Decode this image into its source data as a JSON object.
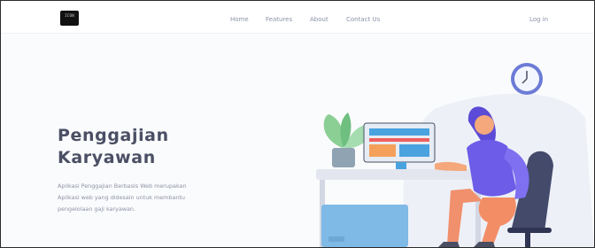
{
  "logo": {
    "text": "ICON"
  },
  "nav": {
    "home": "Home",
    "features": "Features",
    "about": "About",
    "contact": "Contact Us",
    "login": "Log in"
  },
  "hero": {
    "title_line1": "Penggajian",
    "title_line2": "Karyawan",
    "desc_line1": "Aplikasi Penggajian Berbasis Web merupakan",
    "desc_line2": "Aplikasi web yang didesain untuk membantu",
    "desc_line3": "pengelolaan gaji karyawan."
  },
  "colors": {
    "accent": "#6c5ce7",
    "navy": "#4b4f64",
    "plant": "#8bcf95",
    "screen_blue": "#4aa3df"
  },
  "icons": [
    "clock-icon",
    "computer-monitor",
    "plant",
    "office-chair",
    "person-illustration"
  ]
}
